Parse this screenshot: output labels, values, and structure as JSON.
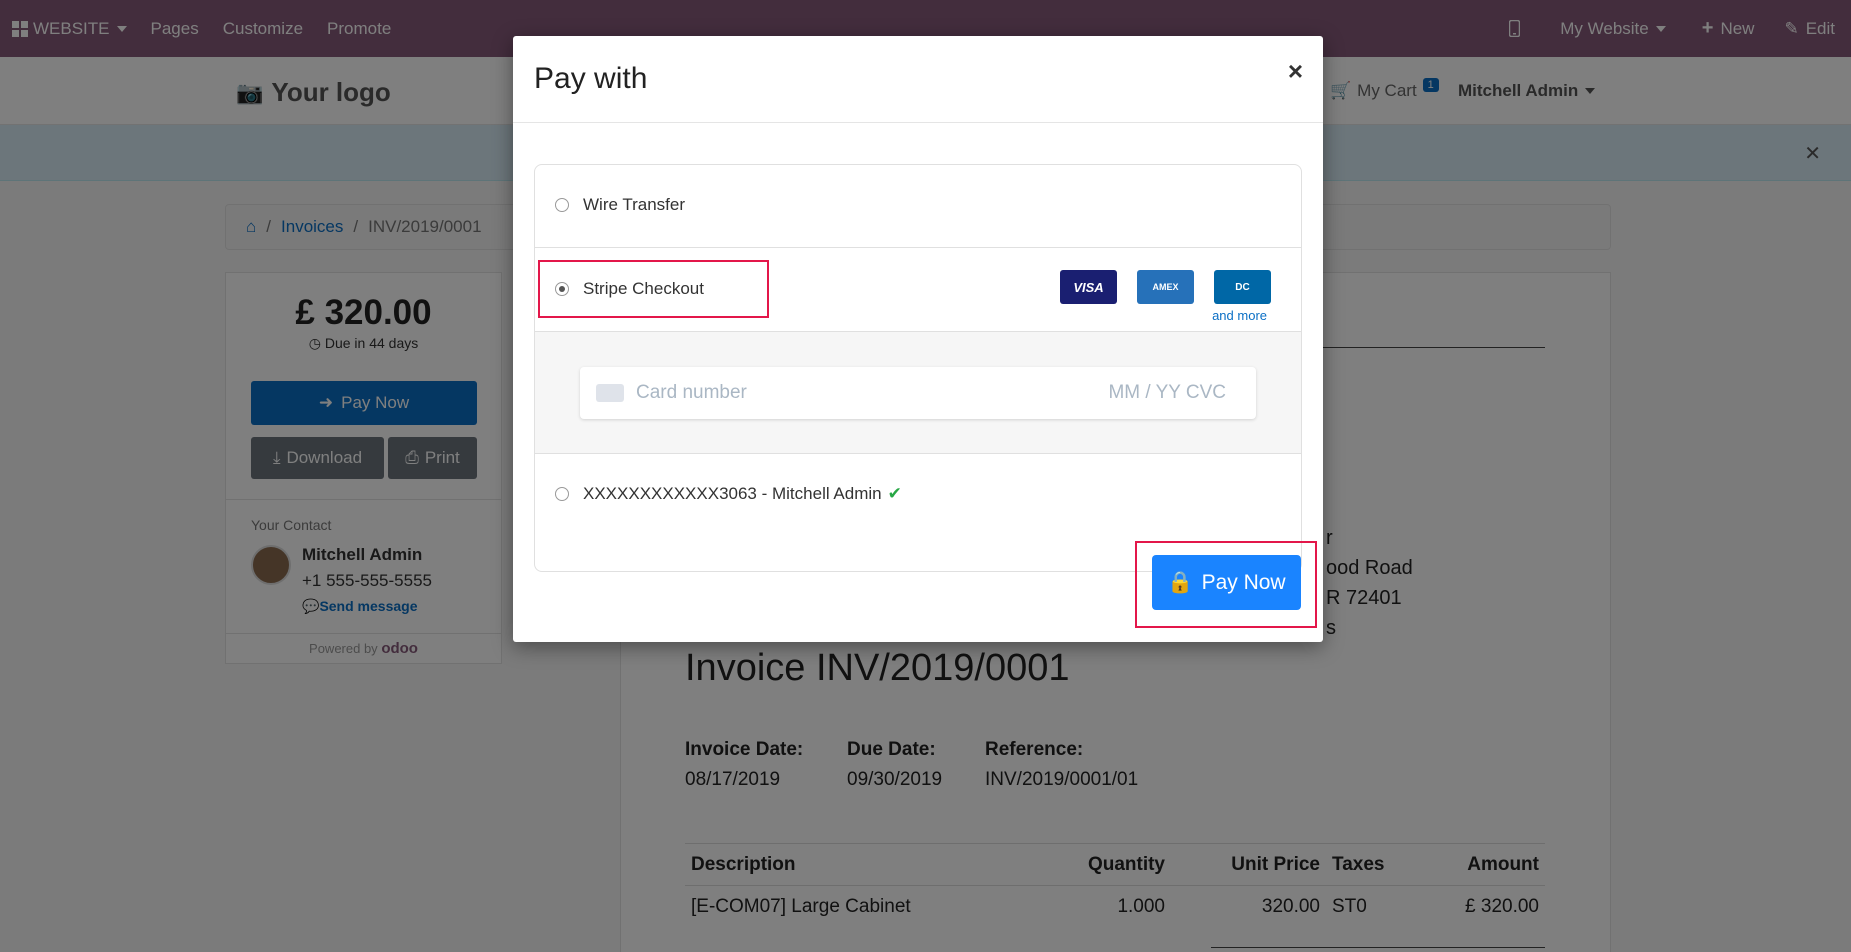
{
  "topbar": {
    "app_label": "WEBSITE",
    "menu": [
      "Pages",
      "Customize",
      "Promote"
    ],
    "site_selector": "My Website",
    "new_label": "New",
    "edit_label": "Edit"
  },
  "header": {
    "logo_text": "Your logo",
    "cart_label": "My Cart",
    "cart_count": "1",
    "user_name": "Mitchell Admin"
  },
  "breadcrumb": {
    "separator": "/",
    "items": [
      "Invoices",
      "INV/2019/0001"
    ]
  },
  "sidebar": {
    "amount": "£ 320.00",
    "due_text": "Due in 44 days",
    "pay_now_label": "Pay Now",
    "download_label": "Download",
    "print_label": "Print",
    "contact_title": "Your Contact",
    "contact_name": "Mitchell Admin",
    "contact_phone": "+1 555-555-5555",
    "send_message_label": "Send message",
    "powered_by": "Powered by",
    "powered_brand": "odoo"
  },
  "invoice": {
    "partner_lines": [
      "r",
      "ood Road",
      "R 72401",
      "s"
    ],
    "title": "Invoice INV/2019/0001",
    "invoice_date_label": "Invoice Date:",
    "invoice_date": "08/17/2019",
    "due_date_label": "Due Date:",
    "due_date": "09/30/2019",
    "reference_label": "Reference:",
    "reference": "INV/2019/0001/01",
    "columns": [
      "Description",
      "Quantity",
      "Unit Price",
      "Taxes",
      "Amount"
    ],
    "rows": [
      [
        "[E-COM07] Large Cabinet",
        "1.000",
        "320.00",
        "ST0",
        "£ 320.00"
      ]
    ]
  },
  "modal": {
    "title": "Pay with",
    "close": "×",
    "methods": {
      "wire": "Wire Transfer",
      "stripe": "Stripe Checkout",
      "saved": "XXXXXXXXXXXX3063 - Mitchell Admin"
    },
    "card_logos": [
      "VISA",
      "AMEX",
      "DC"
    ],
    "and_more": "and more",
    "card_placeholder": "Card number",
    "mmyy_cvc": "MM / YY  CVC",
    "pay_now_label": "Pay Now"
  },
  "colors": {
    "topbar": "#875a7b",
    "primary": "#0b6fc5",
    "highlight": "#e3174a"
  }
}
